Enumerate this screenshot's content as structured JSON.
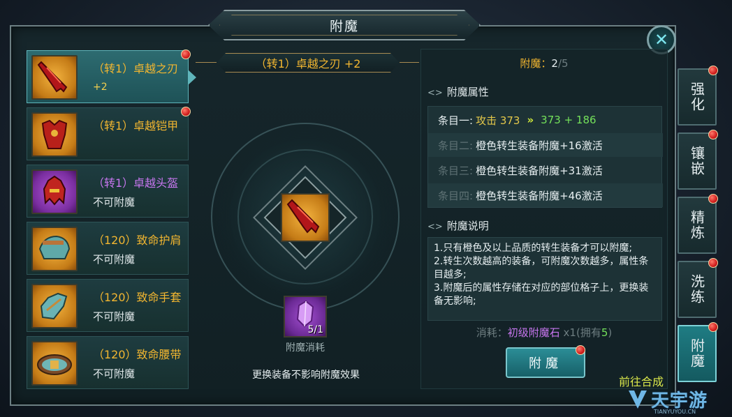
{
  "window": {
    "title": "附魔"
  },
  "equipment_list": [
    {
      "name": "（转1）卓越之刃",
      "sub": "+2",
      "quality": "orange",
      "active": true,
      "badge": true,
      "icon": "blade-icon"
    },
    {
      "name": "（转1）卓越铠甲",
      "sub": "",
      "quality": "orange",
      "active": false,
      "badge": true,
      "icon": "armor-icon"
    },
    {
      "name": "（转1）卓越头盔",
      "sub": "不可附魔",
      "quality": "purple",
      "active": false,
      "badge": false,
      "icon": "helmet-icon"
    },
    {
      "name": "（120）致命护肩",
      "sub": "不可附魔",
      "quality": "orange",
      "active": false,
      "badge": false,
      "icon": "shoulder-icon"
    },
    {
      "name": "（120）致命手套",
      "sub": "不可附魔",
      "quality": "orange",
      "active": false,
      "badge": false,
      "icon": "gloves-icon"
    },
    {
      "name": "（120）致命腰带",
      "sub": "不可附魔",
      "quality": "orange",
      "active": false,
      "badge": false,
      "icon": "belt-icon"
    }
  ],
  "center": {
    "item_title": "（转1）卓越之刃 +2",
    "material_count": "5/1",
    "material_label": "附魔消耗",
    "note": "更换装备不影响附魔效果"
  },
  "enchant": {
    "count_label": "附魔：",
    "count_current": "2",
    "count_sep": "/",
    "count_max": "5",
    "attr_title": "附魔属性",
    "attrs": [
      {
        "key": "条目一:",
        "value": "攻击 373",
        "next": "373 + 186",
        "locked": false
      },
      {
        "key": "条目二:",
        "value": "橙色转生装备附魔+16激活",
        "locked": true
      },
      {
        "key": "条目三:",
        "value": "橙色转生装备附魔+31激活",
        "locked": true
      },
      {
        "key": "条目四:",
        "value": "橙色转生装备附魔+46激活",
        "locked": true
      }
    ],
    "desc_title": "附魔说明",
    "desc_lines": [
      "1.只有橙色及以上品质的转生装备才可以附魔;",
      "2.转生次数越高的装备，可附魔次数越多，属性条目越多;",
      "3.附魔后的属性存储在对应的部位格子上，更换装备无影响;"
    ],
    "cost_label": "消耗：",
    "cost_item": "初级附魔石",
    "cost_qty": " x1(拥有",
    "cost_own": "5",
    "cost_end": ")",
    "button_label": "附魔",
    "synth_link": "前往合成"
  },
  "side_tabs": [
    {
      "label": "强化",
      "active": false
    },
    {
      "label": "镶嵌",
      "active": false
    },
    {
      "label": "精炼",
      "active": false
    },
    {
      "label": "洗练",
      "active": false
    },
    {
      "label": "附魔",
      "active": true
    }
  ],
  "watermark": {
    "text": "天宇游",
    "sub": "TIANYUYOU.CN"
  },
  "colors": {
    "orange_text": "#f2b630",
    "purple_text": "#c776ef",
    "green_text": "#74e15a",
    "accent": "#2b8d96"
  }
}
